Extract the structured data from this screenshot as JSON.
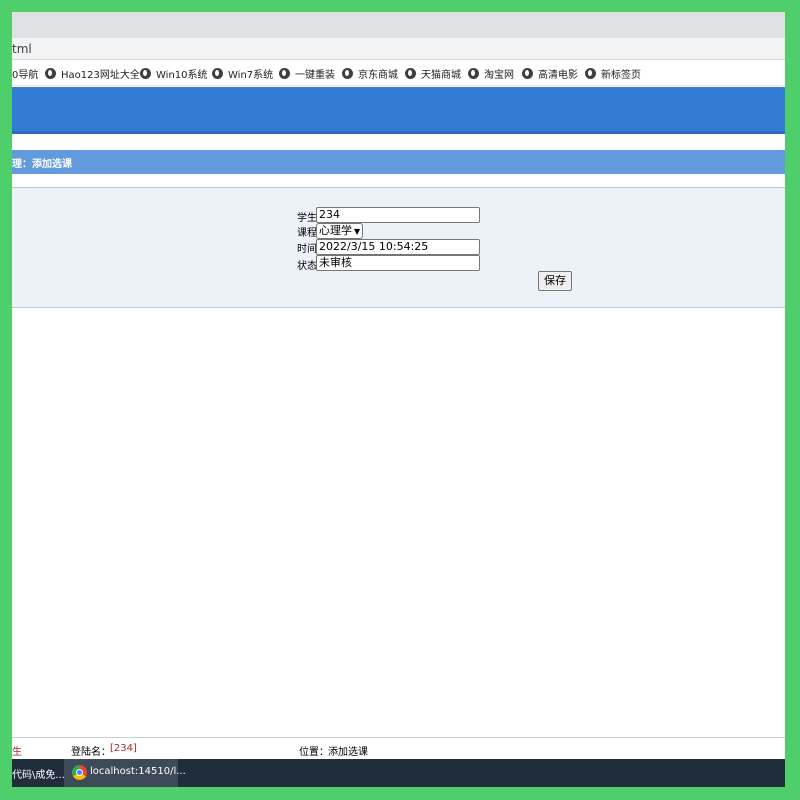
{
  "browser": {
    "address_fragment": "tml"
  },
  "bookmarks": [
    {
      "label": "0导航"
    },
    {
      "label": "Hao123网址大全"
    },
    {
      "label": "Win10系统"
    },
    {
      "label": "Win7系统"
    },
    {
      "label": "一键重装"
    },
    {
      "label": "京东商城"
    },
    {
      "label": "天猫商城"
    },
    {
      "label": "淘宝网"
    },
    {
      "label": "高清电影"
    },
    {
      "label": "新标签页"
    }
  ],
  "page": {
    "title": "理：添加选课"
  },
  "form": {
    "student_label": "学生",
    "student_value": "234",
    "course_label": "课程",
    "course_value": "心理学",
    "time_label": "时间",
    "time_value": "2022/3/15 10:54:25",
    "status_label": "状态",
    "status_value": "未审核",
    "save_label": "保存"
  },
  "statusbar": {
    "role": "生",
    "login_label": "登陆名：",
    "login_value": "[234]",
    "position_label": "位置：",
    "position_value": "添加选课"
  },
  "taskbar": {
    "item1": "代码\\成免...",
    "item2": "localhost:14510/l..."
  },
  "colors": {
    "frame": "#4fcf6b",
    "banner": "#347bd5",
    "titlebar": "#6399dd",
    "form_bg": "#edf2f9",
    "taskbar": "#1f2d3d"
  }
}
